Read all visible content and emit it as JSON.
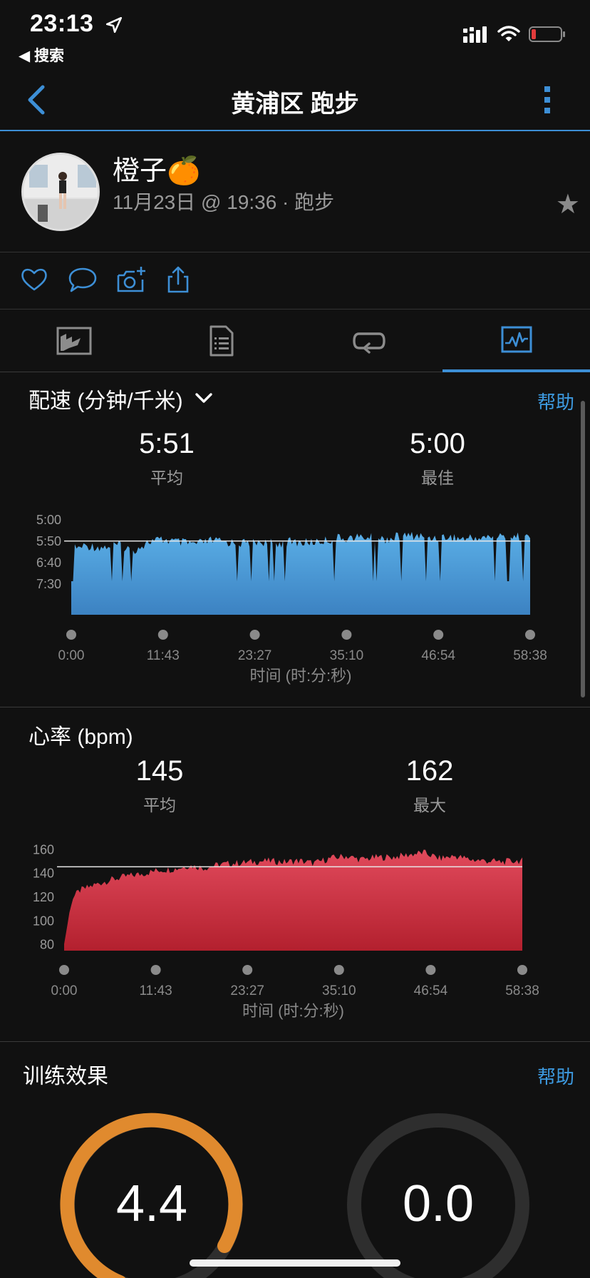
{
  "status_bar": {
    "time": "23:13",
    "back_app": "◀ 搜索",
    "icons": [
      "location-arrow-icon",
      "signal-icon",
      "wifi-icon",
      "battery-low-icon"
    ]
  },
  "nav": {
    "title": "黄浦区 跑步",
    "icons": [
      "back-chevron-icon",
      "more-vertical-icon"
    ]
  },
  "profile": {
    "name": "橙子🍊",
    "date": "11月23日 @ 19:36 · 跑步",
    "star": "★"
  },
  "actions": {
    "icons": [
      "heart-icon",
      "comment-icon",
      "camera-plus-icon",
      "share-icon"
    ]
  },
  "tabs": {
    "items": [
      "map-tab-icon",
      "details-tab-icon",
      "laps-tab-icon",
      "charts-tab-icon"
    ],
    "active_index": 3
  },
  "pace": {
    "title": "配速 (分钟/千米)",
    "help": "帮助",
    "avg_value": "5:51",
    "avg_label": "平均",
    "best_value": "5:00",
    "best_label": "最佳"
  },
  "heart": {
    "title": "心率 (bpm)",
    "avg_value": "145",
    "avg_label": "平均",
    "max_value": "162",
    "max_label": "最大"
  },
  "training": {
    "title": "训练效果",
    "help": "帮助",
    "aerobic_value": "4.4",
    "anaerobic_value": "0.0"
  },
  "colors": {
    "accent": "#3d8fd6",
    "pace_fill": "#4a9ad6",
    "hr_fill": "#c52b3c",
    "aerobic_ring": "#e08a2e",
    "ring_track": "#2e2e2e"
  },
  "chart_data": [
    {
      "type": "area",
      "title": "配速 (分钟/千米)",
      "xlabel": "时间 (时:分:秒)",
      "x_ticks": [
        "0:00",
        "11:43",
        "23:27",
        "35:10",
        "46:54",
        "58:38"
      ],
      "y_ticks": [
        "5:00",
        "5:50",
        "6:40",
        "7:30"
      ],
      "reference_line": "5:51",
      "x_minutes": [
        0,
        2,
        4,
        6,
        8,
        10,
        12,
        14,
        16,
        18,
        20,
        22,
        24,
        26,
        28,
        30,
        32,
        34,
        36,
        38,
        40,
        42,
        44,
        46,
        48,
        50,
        52,
        54,
        56,
        58
      ],
      "pace_sec_per_km": [
        370,
        362,
        366,
        360,
        372,
        352,
        348,
        355,
        358,
        350,
        354,
        356,
        352,
        357,
        353,
        355,
        351,
        345,
        343,
        342,
        347,
        340,
        338,
        344,
        341,
        346,
        343,
        342,
        340,
        342
      ],
      "ylim": [
        "5:00",
        "7:30"
      ]
    },
    {
      "type": "area",
      "title": "心率 (bpm)",
      "xlabel": "时间 (时:分:秒)",
      "x_ticks": [
        "0:00",
        "11:43",
        "23:27",
        "35:10",
        "46:54",
        "58:38"
      ],
      "y_ticks": [
        160,
        140,
        120,
        100,
        80
      ],
      "reference_line": 145,
      "x_minutes": [
        0,
        1,
        2,
        4,
        6,
        8,
        10,
        12,
        14,
        16,
        18,
        20,
        22,
        24,
        26,
        28,
        30,
        32,
        34,
        36,
        38,
        40,
        42,
        44,
        46,
        48,
        50,
        52,
        54,
        56,
        58
      ],
      "values": [
        80,
        118,
        125,
        130,
        134,
        137,
        139,
        142,
        143,
        146,
        144,
        147,
        148,
        149,
        150,
        149,
        150,
        148,
        152,
        154,
        151,
        153,
        153,
        155,
        157,
        152,
        154,
        151,
        150,
        149,
        150
      ],
      "ylim": [
        75,
        165
      ]
    }
  ]
}
